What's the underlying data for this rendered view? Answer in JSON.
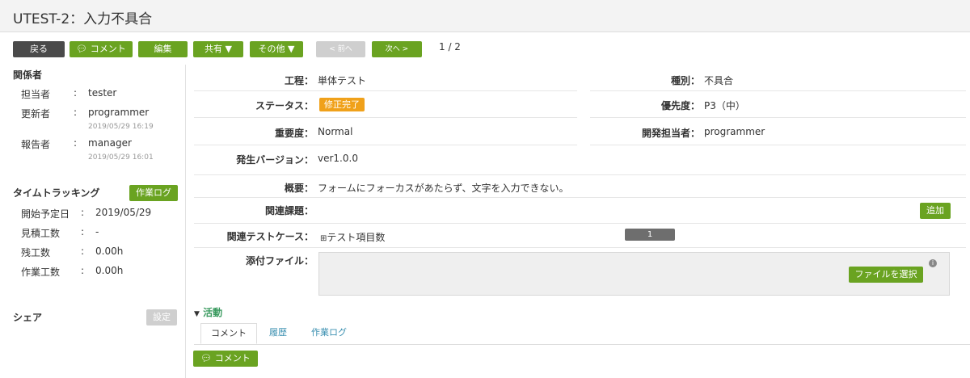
{
  "title": "UTEST-2：入力不具合",
  "toolbar": {
    "back": "戻る",
    "comment": "コメント",
    "edit": "編集",
    "share": "共有 ▼",
    "other": "その他 ▼",
    "prev": "< 前へ",
    "next": "次へ >",
    "pager": "1 / 2"
  },
  "sidebar": {
    "people_heading": "関係者",
    "people": [
      {
        "label": "担当者",
        "sep": ":",
        "name": "tester",
        "time": ""
      },
      {
        "label": "更新者",
        "sep": ":",
        "name": "programmer",
        "time": "2019/05/29 16:19"
      },
      {
        "label": "報告者",
        "sep": ":",
        "name": "manager",
        "time": "2019/05/29 16:01"
      }
    ],
    "time_heading": "タイムトラッキング",
    "worklog_button": "作業ログ",
    "time_rows": [
      {
        "label": "開始予定日",
        "sep": ":",
        "value": "2019/05/29"
      },
      {
        "label": "見積工数",
        "sep": ":",
        "value": "-"
      },
      {
        "label": "残工数",
        "sep": ":",
        "value": "0.00h"
      },
      {
        "label": "作業工数",
        "sep": ":",
        "value": "0.00h"
      }
    ],
    "share_heading": "シェア",
    "share_button": "設定"
  },
  "fields": {
    "process_label": "工程：",
    "process_value": "単体テスト",
    "type_label": "種別：",
    "type_value": "不具合",
    "status_label": "ステータス：",
    "status_value": "修正完了",
    "priority_label": "優先度：",
    "priority_value": "P3（中）",
    "severity_label": "重要度：",
    "severity_value": "Normal",
    "dev_label": "開発担当者：",
    "dev_value": "programmer",
    "version_label": "発生バージョン：",
    "version_value": "ver1.0.0",
    "summary_label": "概要：",
    "summary_value": "フォームにフォーカスがあたらず、文字を入力できない。",
    "related_label": "関連課題：",
    "add_button": "追加",
    "testcase_label": "関連テストケース：",
    "testcase_value": "テスト項目数",
    "testcase_count": "1",
    "attach_label": "添付ファイル：",
    "file_button": "ファイルを選択"
  },
  "activity": {
    "heading": "活動",
    "tabs": [
      "コメント",
      "履歴",
      "作業ログ"
    ],
    "comment_button": "コメント"
  },
  "colors": {
    "green": "#6aa321",
    "status": "#f0a11a",
    "dark": "#4a4a4a"
  }
}
